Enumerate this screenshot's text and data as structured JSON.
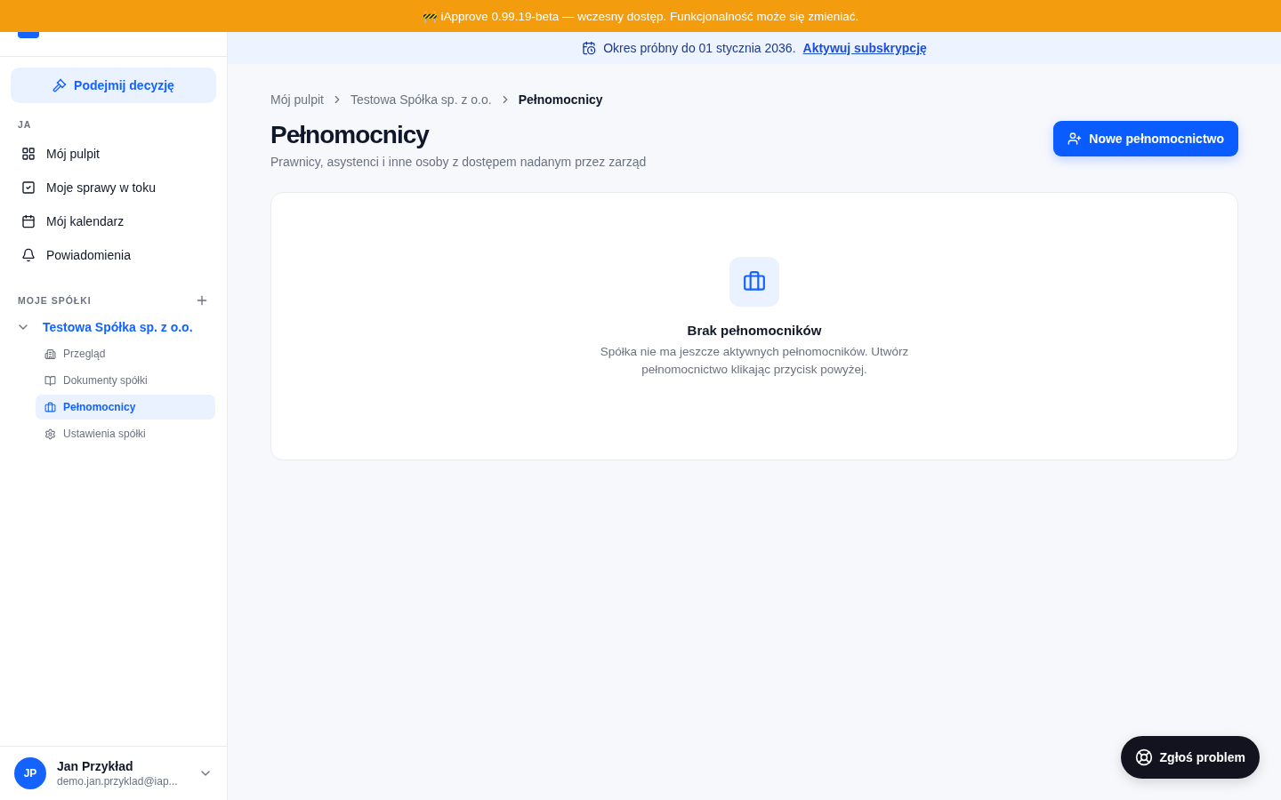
{
  "banner": {
    "icon": "🚧",
    "text": "iApprove 0.99.19-beta — wczesny dostęp. Funkcjonalność może się zmieniać."
  },
  "sidebar": {
    "action": "Podejmij decyzję",
    "section_me": "JA",
    "items": [
      {
        "label": "Mój pulpit",
        "selected": false
      },
      {
        "label": "Moje sprawy w toku",
        "selected": false
      },
      {
        "label": "Mój kalendarz",
        "selected": false
      },
      {
        "label": "Powiadomienia",
        "selected": false
      }
    ],
    "section_companies": "MOJE SPÓŁKI",
    "company": {
      "name": "Testowa Spółka sp. z o.o.",
      "expanded": true,
      "children": [
        {
          "label": "Przegląd",
          "selected": false
        },
        {
          "label": "Dokumenty spółki",
          "selected": false
        },
        {
          "label": "Pełnomocnicy",
          "selected": true
        },
        {
          "label": "Ustawienia spółki",
          "selected": false
        }
      ]
    },
    "user": {
      "initials": "JP",
      "name": "Jan Przykład",
      "email": "demo.jan.przyklad@iap..."
    }
  },
  "trial": {
    "text": "Okres próbny do 01 stycznia 2036.",
    "link": "Aktywuj subskrypcję"
  },
  "breadcrumbs": [
    {
      "label": "Mój pulpit",
      "selected": false
    },
    {
      "label": "Testowa Spółka sp. z o.o.",
      "selected": false
    },
    {
      "label": "Pełnomocnicy",
      "selected": true
    }
  ],
  "page": {
    "title": "Pełnomocnicy",
    "subtitle": "Prawnicy, asystenci i inne osoby z dostępem nadanym przez zarząd",
    "button": "Nowe pełnomocnictwo"
  },
  "empty": {
    "title": "Brak pełnomocników",
    "text": "Spółka nie ma jeszcze aktywnych pełnomocników. Utwórz pełnomocnictwo klikając przycisk powyżej."
  },
  "help_button": "Zgłoś problem"
}
